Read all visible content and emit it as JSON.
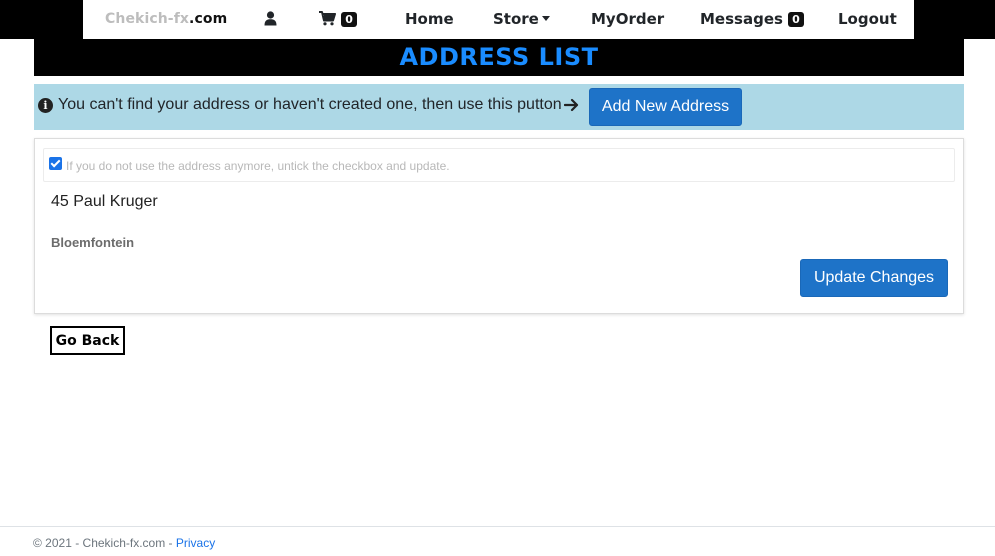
{
  "nav": {
    "brand_part1": "Chekich-fx",
    "brand_part2": ".com",
    "user_icon": "user-icon",
    "cart_icon": "cart-icon",
    "cart_count": "0",
    "home": "Home",
    "store": "Store",
    "myorder": "MyOrder",
    "messages": "Messages",
    "messages_count": "0",
    "logout": "Logout"
  },
  "page": {
    "title": "ADDRESS LIST",
    "title_color": "#1a8cff"
  },
  "info": {
    "icon": "info-circle-icon",
    "text": "You can't find your address or haven't created one, then use this putton",
    "arrow_icon": "arrow-right-icon",
    "add_button": "Add New Address"
  },
  "address": {
    "checked": true,
    "check_text": "If you do not use the address anymore, untick the checkbox and update.",
    "street": "45 Paul Kruger",
    "city": "Bloemfontein",
    "update_button": "Update Changes"
  },
  "go_back": "Go Back",
  "footer": {
    "text": "© 2021 - Chekich-fx.com - ",
    "privacy": "Privacy"
  },
  "colors": {
    "info_band": "#add8e6",
    "primary_button": "#1e73c8"
  }
}
